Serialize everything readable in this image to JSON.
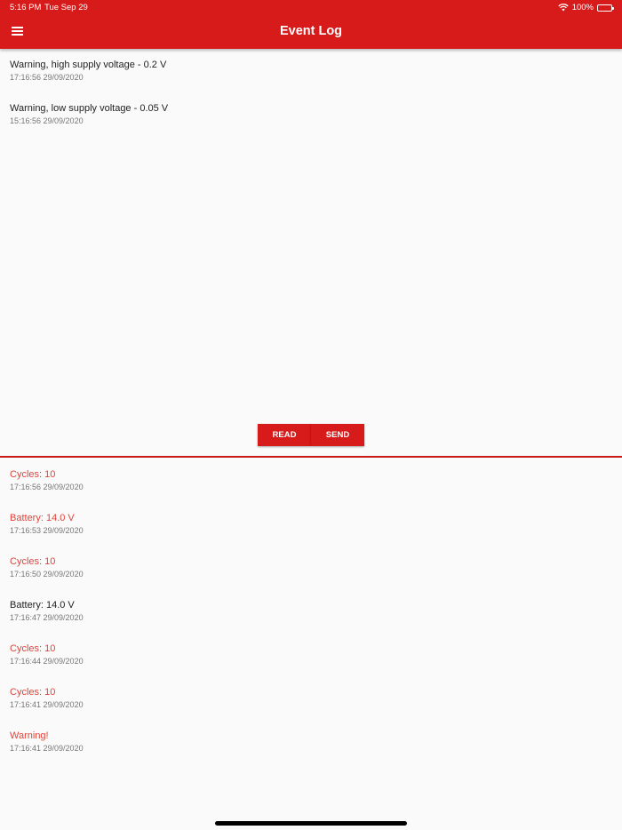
{
  "status_bar": {
    "time": "5:16 PM",
    "date": "Tue Sep 29",
    "battery": "100%"
  },
  "app_bar": {
    "title": "Event Log",
    "menu_icon": "hamburger-menu-icon"
  },
  "event_log": [
    {
      "message": "Warning, high supply voltage - 0.2 V",
      "timestamp": "17:16:56 29/09/2020"
    },
    {
      "message": "Warning, low supply voltage - 0.05 V",
      "timestamp": "15:16:56 29/09/2020"
    }
  ],
  "actions": {
    "read_label": "READ",
    "send_label": "SEND"
  },
  "message_log": [
    {
      "message": "Cycles: 10",
      "timestamp": "17:16:56 29/09/2020",
      "color": "red"
    },
    {
      "message": "Battery: 14.0 V",
      "timestamp": "17:16:53 29/09/2020",
      "color": "red"
    },
    {
      "message": "Cycles: 10",
      "timestamp": "17:16:50 29/09/2020",
      "color": "red"
    },
    {
      "message": "Battery: 14.0 V",
      "timestamp": "17:16:47 29/09/2020",
      "color": "black"
    },
    {
      "message": "Cycles: 10",
      "timestamp": "17:16:44 29/09/2020",
      "color": "red"
    },
    {
      "message": "Cycles: 10",
      "timestamp": "17:16:41 29/09/2020",
      "color": "red"
    },
    {
      "message": "Warning!",
      "timestamp": "17:16:41 29/09/2020",
      "color": "red"
    }
  ],
  "colors": {
    "accent": "#d71a1a",
    "received_text": "#e0433a",
    "sent_text": "#222222"
  }
}
